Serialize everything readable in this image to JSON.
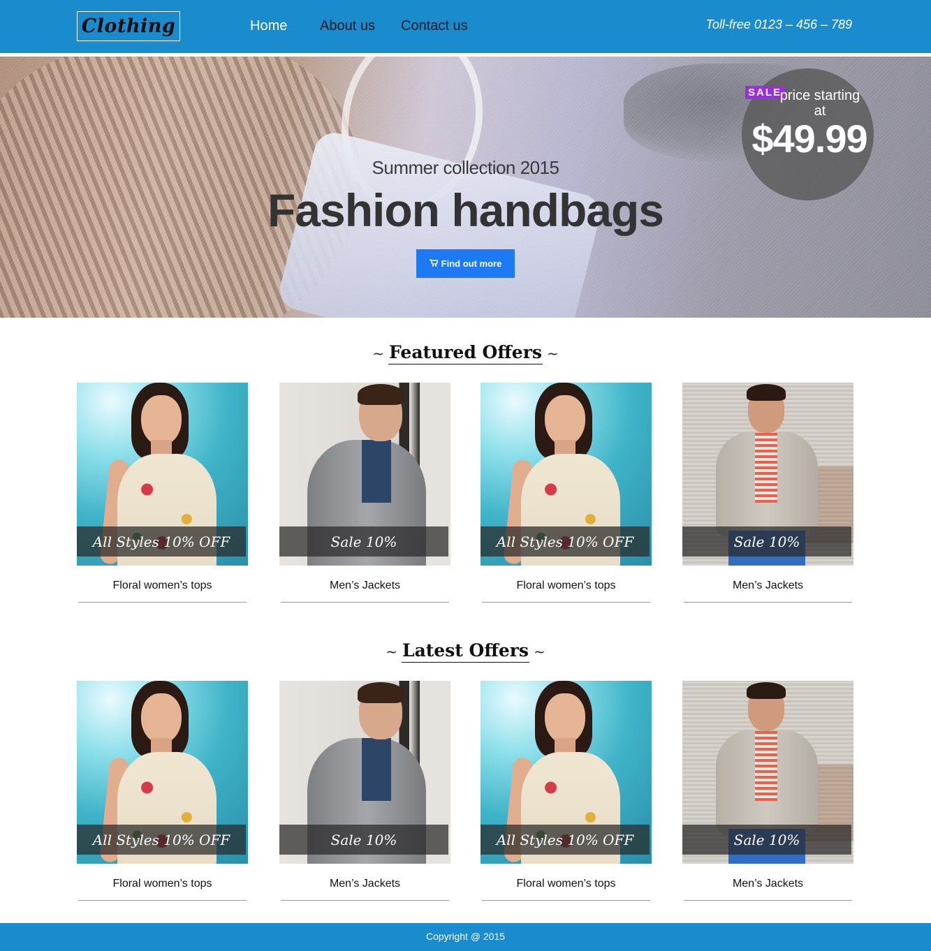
{
  "header": {
    "logo_text": "Clothing",
    "nav": [
      {
        "label": "Home"
      },
      {
        "label": "About us"
      },
      {
        "label": "Contact us"
      }
    ],
    "tollfree": "Toll-free 0123 – 456 – 789",
    "brand_color": "#1a8ccd"
  },
  "hero": {
    "subtitle": "Summer collection 2015",
    "title": "Fashion handbags",
    "button_label": "Find out more",
    "button_icon": "cart-icon",
    "sale": {
      "badge": "SALE",
      "label": "price starting at",
      "price": "$49.99"
    }
  },
  "featured": {
    "title": "Featured Offers",
    "items": [
      {
        "caption": "All Styles 10% OFF",
        "name": "Floral women’s tops",
        "image": "woman-floral-top"
      },
      {
        "caption": "Sale 10%",
        "name": "Men’s Jackets",
        "image": "man-grey-jacket"
      },
      {
        "caption": "All Styles 10% OFF",
        "name": "Floral women’s tops",
        "image": "woman-floral-top"
      },
      {
        "caption": "Sale 10%",
        "name": "Men’s Jackets",
        "image": "man-cardigan"
      }
    ]
  },
  "latest": {
    "title": "Latest Offers",
    "items": [
      {
        "caption": "All Styles 10% OFF",
        "name": "Floral women’s tops",
        "image": "woman-floral-top"
      },
      {
        "caption": "Sale 10%",
        "name": "Men’s Jackets",
        "image": "man-grey-jacket"
      },
      {
        "caption": "All Styles 10% OFF",
        "name": "Floral women’s tops",
        "image": "woman-floral-top"
      },
      {
        "caption": "Sale 10%",
        "name": "Men’s Jackets",
        "image": "man-cardigan"
      }
    ]
  },
  "footer": {
    "copyright": "Copyright @ 2015"
  }
}
